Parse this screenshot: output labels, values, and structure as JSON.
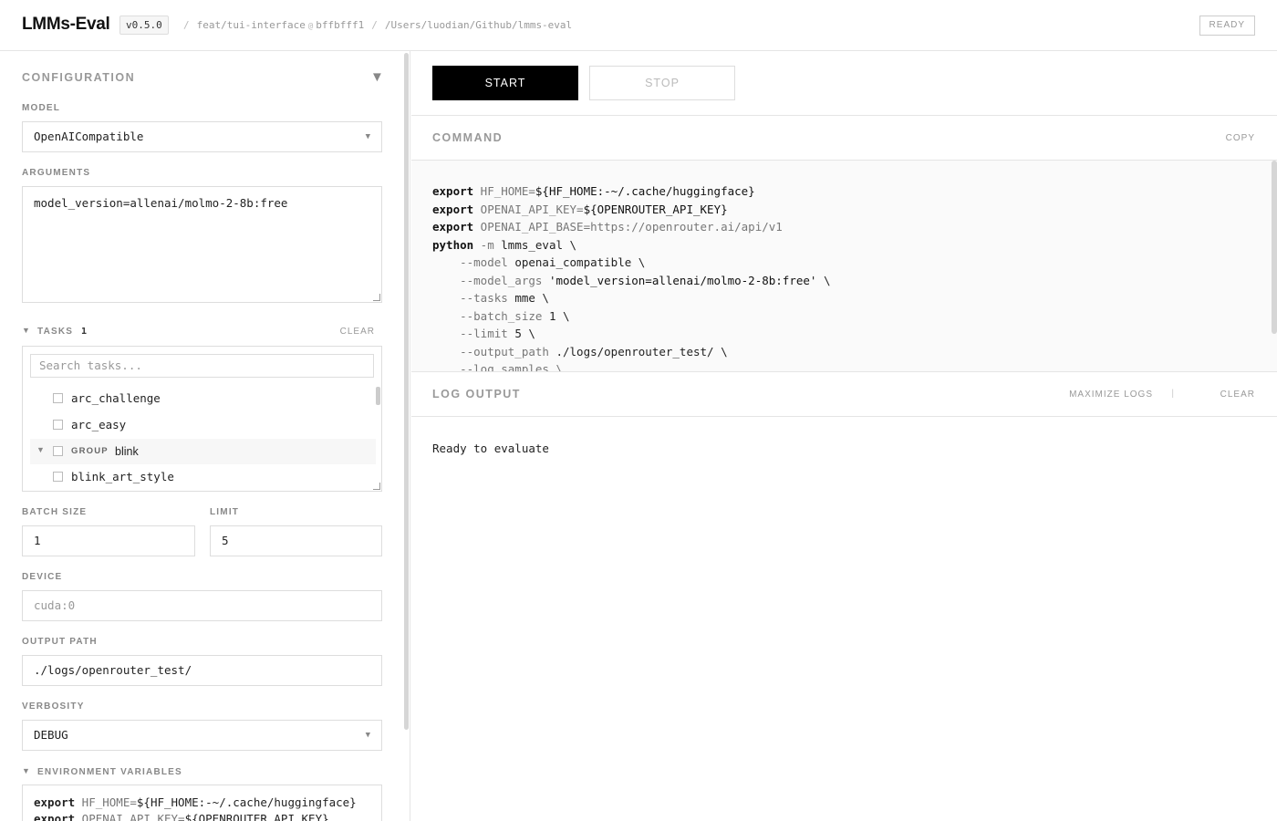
{
  "header": {
    "title": "LMMs-Eval",
    "version": "v0.5.0",
    "branch": "feat/tui-interface",
    "at": "@",
    "commit": "bffbfff1",
    "sep": "/",
    "path": "/Users/luodian/Github/lmms-eval",
    "status": "READY"
  },
  "config": {
    "title": "CONFIGURATION",
    "collapse_icon": "▼",
    "model_label": "MODEL",
    "model_value": "OpenAICompatible",
    "arguments_label": "ARGUMENTS",
    "arguments_value": "model_version=allenai/molmo-2-8b:free",
    "tasks": {
      "label": "TASKS",
      "count": "1",
      "clear": "CLEAR",
      "search_placeholder": "Search tasks...",
      "items": [
        {
          "name": "arc_challenge"
        },
        {
          "name": "arc_easy"
        },
        {
          "group_tag": "GROUP",
          "name": "blink"
        },
        {
          "name": "blink_art_style"
        }
      ]
    },
    "batch_size_label": "BATCH SIZE",
    "batch_size_value": "1",
    "limit_label": "LIMIT",
    "limit_value": "5",
    "device_label": "DEVICE",
    "device_placeholder": "cuda:0",
    "output_path_label": "OUTPUT PATH",
    "output_path_value": "./logs/openrouter_test/",
    "verbosity_label": "VERBOSITY",
    "verbosity_value": "DEBUG",
    "env_label": "ENVIRONMENT VARIABLES",
    "env_lines": [
      {
        "kw": "export",
        "name": " HF_HOME=",
        "val": "${HF_HOME:-~/.cache/huggingface}"
      },
      {
        "kw": "export",
        "name": " OPENAI_API_KEY=",
        "val": "${OPENROUTER_API_KEY}"
      }
    ]
  },
  "actions": {
    "start": "START",
    "stop": "STOP"
  },
  "command": {
    "title": "COMMAND",
    "copy": "COPY",
    "lines": {
      "l1kw": "export",
      "l1a": " HF_HOME=",
      "l1b": "${HF_HOME:-~/.cache/huggingface}",
      "l2kw": "export",
      "l2a": " OPENAI_API_KEY=",
      "l2b": "${OPENROUTER_API_KEY}",
      "l3kw": "export",
      "l3a": " OPENAI_API_BASE=",
      "l3b": "https://openrouter.ai/api/v1",
      "l4kw": "python",
      "l4a": " -m ",
      "l4b": "lmms_eval \\",
      "l5a": "    --model ",
      "l5b": "openai_compatible \\",
      "l6a": "    --model_args ",
      "l6b": "'model_version=allenai/molmo-2-8b:free'",
      "l6c": " \\",
      "l7a": "    --tasks ",
      "l7b": "mme \\",
      "l8a": "    --batch_size ",
      "l8b": "1 \\",
      "l9a": "    --limit ",
      "l9b": "5 \\",
      "l10a": "    --output_path ",
      "l10b": "./logs/openrouter_test/ \\",
      "l11a": "    --log_samples \\"
    }
  },
  "log": {
    "title": "LOG OUTPUT",
    "maximize": "MAXIMIZE LOGS",
    "divider": "|",
    "clear": "CLEAR",
    "text": "Ready to evaluate"
  }
}
